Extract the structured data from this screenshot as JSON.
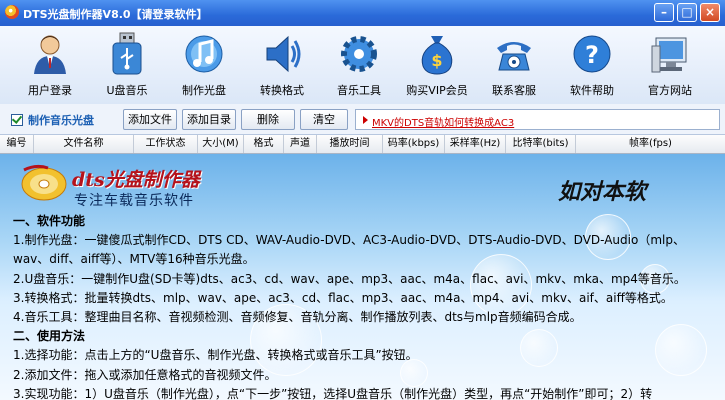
{
  "window": {
    "title": "DTS光盘制作器V8.0【请登录软件】",
    "min": "–",
    "max": "□",
    "close": "×"
  },
  "toolbar": {
    "buttons": [
      {
        "id": "user-login",
        "label": "用户登录"
      },
      {
        "id": "usb-music",
        "label": "U盘音乐"
      },
      {
        "id": "make-disc",
        "label": "制作光盘"
      },
      {
        "id": "convert",
        "label": "转换格式"
      },
      {
        "id": "music-tools",
        "label": "音乐工具"
      },
      {
        "id": "buy-vip",
        "label": "购买VIP会员"
      },
      {
        "id": "contact",
        "label": "联系客服"
      },
      {
        "id": "help",
        "label": "软件帮助"
      },
      {
        "id": "website",
        "label": "官方网站"
      }
    ]
  },
  "options": {
    "mode_label": "制作音乐光盘",
    "add_file": "添加文件",
    "add_dir": "添加目录",
    "delete": "删除",
    "clear": "清空",
    "link": "MKV的DTS音轨如何转换成AC3"
  },
  "table": {
    "columns": [
      "编号",
      "文件名称",
      "工作状态",
      "大小(M)",
      "格式",
      "声道",
      "播放时间",
      "码率(kbps)",
      "采样率(Hz)",
      "比特率(bits)",
      "帧率(fps)"
    ]
  },
  "banner": {
    "title": "dts光盘制作器",
    "subtitle": "专注车载音乐软件",
    "slogan": "如对本软"
  },
  "content": {
    "lines": [
      {
        "text": "一、软件功能",
        "sec": true
      },
      {
        "text": "1.制作光盘：一键傻瓜式制作CD、DTS CD、WAV-Audio-DVD、AC3-Audio-DVD、DTS-Audio-DVD、DVD-Audio（mlp、",
        "sec": false
      },
      {
        "text": "wav、diff、aiff等）、MTV等16种音乐光盘。",
        "sec": false
      },
      {
        "text": "2.U盘音乐：一键制作U盘(SD卡等)dts、ac3、cd、wav、ape、mp3、aac、m4a、flac、avi、mkv、mka、mp4等音乐。",
        "sec": false
      },
      {
        "text": "3.转换格式：批量转换dts、mlp、wav、ape、ac3、cd、flac、mp3、aac、m4a、mp4、avi、mkv、aif、aiff等格式。",
        "sec": false
      },
      {
        "text": "4.音乐工具：整理曲目名称、音视频检测、音频修复、音轨分离、制作播放列表、dts与mlp音频编码合成。",
        "sec": false
      },
      {
        "text": "二、使用方法",
        "sec": true
      },
      {
        "text": "1.选择功能：点击上方的“U盘音乐、制作光盘、转换格式或音乐工具”按钮。",
        "sec": false
      },
      {
        "text": "2.添加文件：拖入或添加任意格式的音视频文件。",
        "sec": false
      },
      {
        "text": "3.实现功能：1）U盘音乐（制作光盘），点“下一步”按钮，选择U盘音乐（制作光盘）类型，再点“开始制作”即可；2）转",
        "sec": false
      }
    ]
  }
}
